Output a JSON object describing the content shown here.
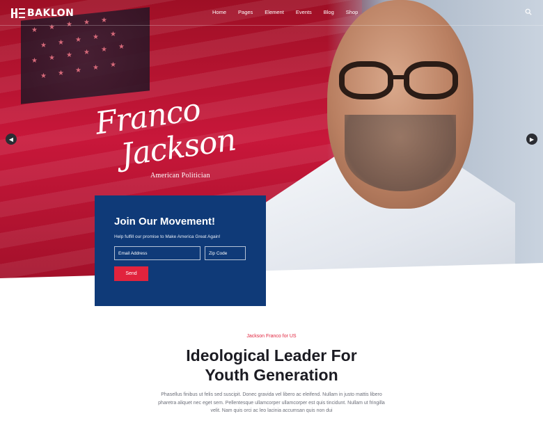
{
  "header": {
    "logo_text": "BAKLON",
    "nav": [
      "Home",
      "Pages",
      "Element",
      "Events",
      "Blog",
      "Shop"
    ]
  },
  "hero": {
    "signature_line1": "Franco",
    "signature_line2": "Jackson",
    "subtitle": "American Politician",
    "prev_label": "◀",
    "next_label": "▶"
  },
  "form": {
    "title": "Join Our Movement!",
    "description": "Help fulfill our promise to Make America Great Again!",
    "email_placeholder": "Email Address",
    "zip_placeholder": "Zip Code",
    "send_label": "Send"
  },
  "intro": {
    "eyebrow": "Jackson Franco for US",
    "headline_line1": "Ideological Leader For",
    "headline_line2": "Youth Generation",
    "paragraph": "Phasellus finibus ut felis sed suscipit. Donec gravida vel libero ac eleifend. Nullam in justo mattis libero pharetra aliquet nec eget sem. Pellentesque ullamcorper ullamcorper est quis tincidunt. Nullam ut fringilla velit. Nam quis orci ac leo lacinia accumsan quis non dui"
  },
  "colors": {
    "accent_red": "#e1233d",
    "card_blue": "#0f3a78"
  }
}
